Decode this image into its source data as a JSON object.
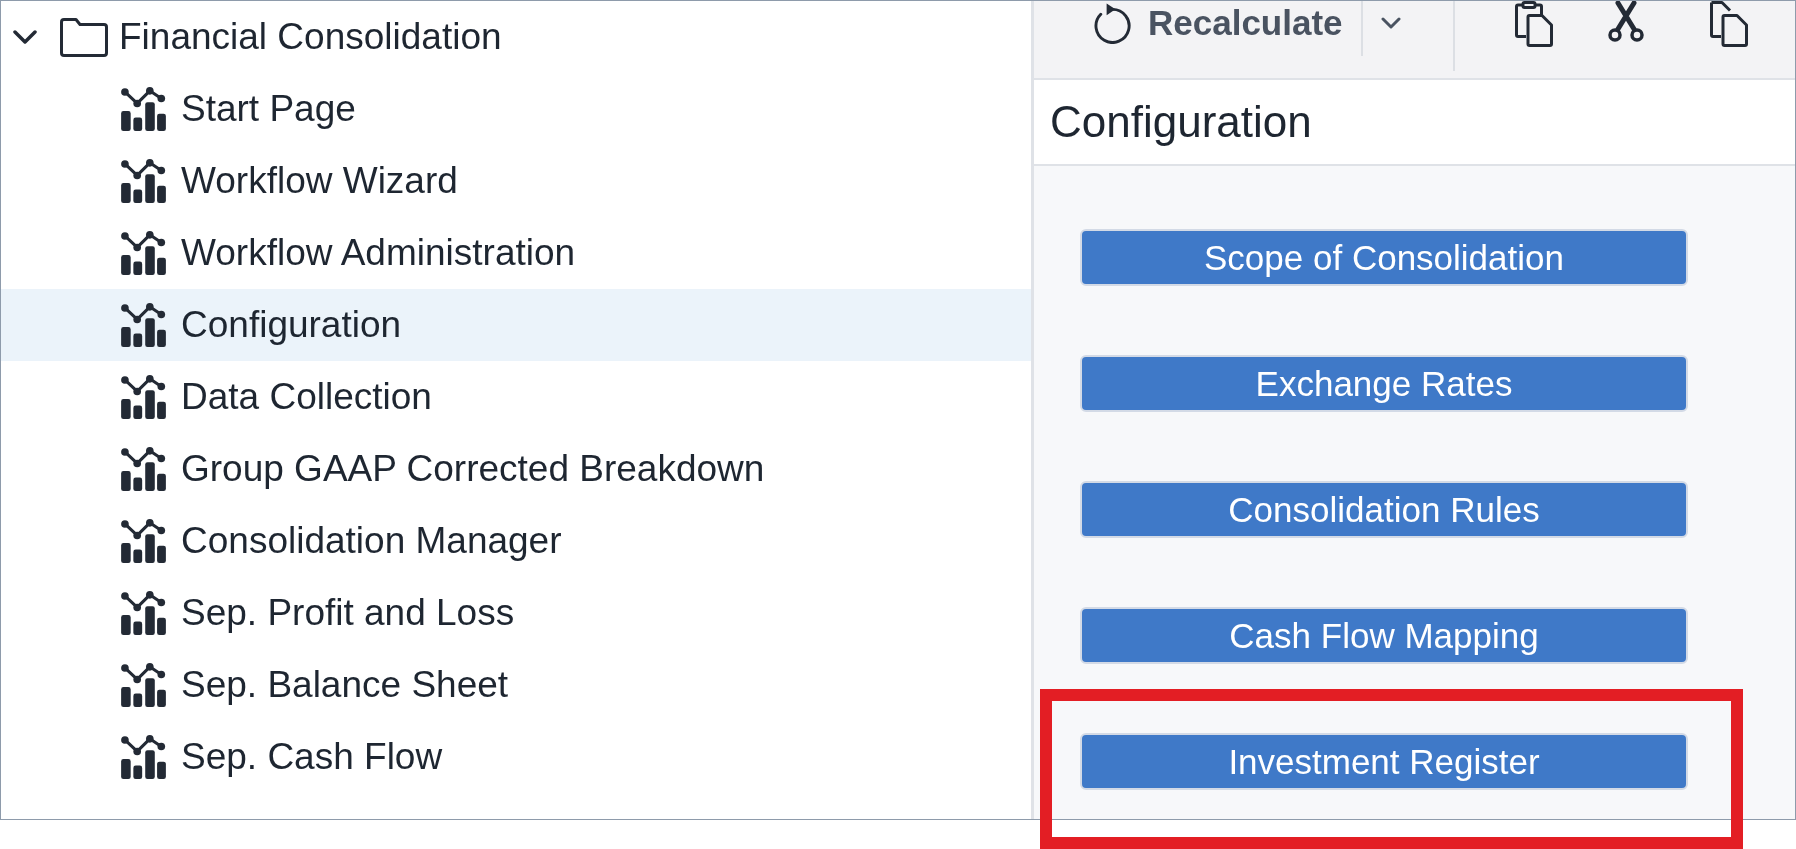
{
  "tree": {
    "root": {
      "label": "Financial Consolidation",
      "expanded": true,
      "selected": false,
      "children": [
        {
          "label": "Start Page",
          "selected": false
        },
        {
          "label": "Workflow Wizard",
          "selected": false
        },
        {
          "label": "Workflow Administration",
          "selected": false
        },
        {
          "label": "Configuration",
          "selected": true
        },
        {
          "label": "Data Collection",
          "selected": false
        },
        {
          "label": "Group GAAP Corrected Breakdown",
          "selected": false
        },
        {
          "label": "Consolidation Manager",
          "selected": false
        },
        {
          "label": "Sep. Profit and Loss",
          "selected": false
        },
        {
          "label": "Sep. Balance Sheet",
          "selected": false
        },
        {
          "label": "Sep. Cash Flow",
          "selected": false
        }
      ]
    }
  },
  "toolbar": {
    "recalculate": {
      "label": "Recalculate"
    }
  },
  "panel": {
    "title": "Configuration",
    "buttons": [
      {
        "label": "Scope of Consolidation"
      },
      {
        "label": "Exchange Rates"
      },
      {
        "label": "Consolidation Rules"
      },
      {
        "label": "Cash Flow Mapping"
      },
      {
        "label": "Investment Register"
      }
    ]
  }
}
